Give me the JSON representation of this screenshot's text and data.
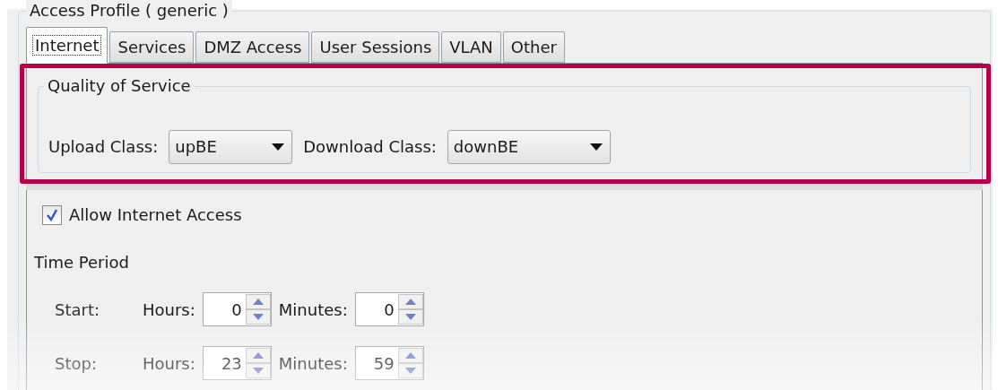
{
  "group_title": "Access Profile ( generic )",
  "tabs": [
    {
      "label": "Internet",
      "selected": true
    },
    {
      "label": "Services",
      "selected": false
    },
    {
      "label": "DMZ Access",
      "selected": false
    },
    {
      "label": "User Sessions",
      "selected": false
    },
    {
      "label": "VLAN",
      "selected": false
    },
    {
      "label": "Other",
      "selected": false
    }
  ],
  "quality_of_service": {
    "title": "Quality of Service",
    "fields": [
      {
        "label": "Upload Class:",
        "value": "upBE"
      },
      {
        "label": "Download Class:",
        "value": "downBE"
      }
    ]
  },
  "allow_internet_access": {
    "label": "Allow Internet Access",
    "checked": true
  },
  "time_period": {
    "title": "Time Period",
    "rows": [
      {
        "label": "Start:",
        "hours_label": "Hours:",
        "hours": "0",
        "minutes_label": "Minutes:",
        "minutes": "0"
      },
      {
        "label": "Stop:",
        "hours_label": "Hours:",
        "hours": "23",
        "minutes_label": "Minutes:",
        "minutes": "59"
      }
    ]
  }
}
